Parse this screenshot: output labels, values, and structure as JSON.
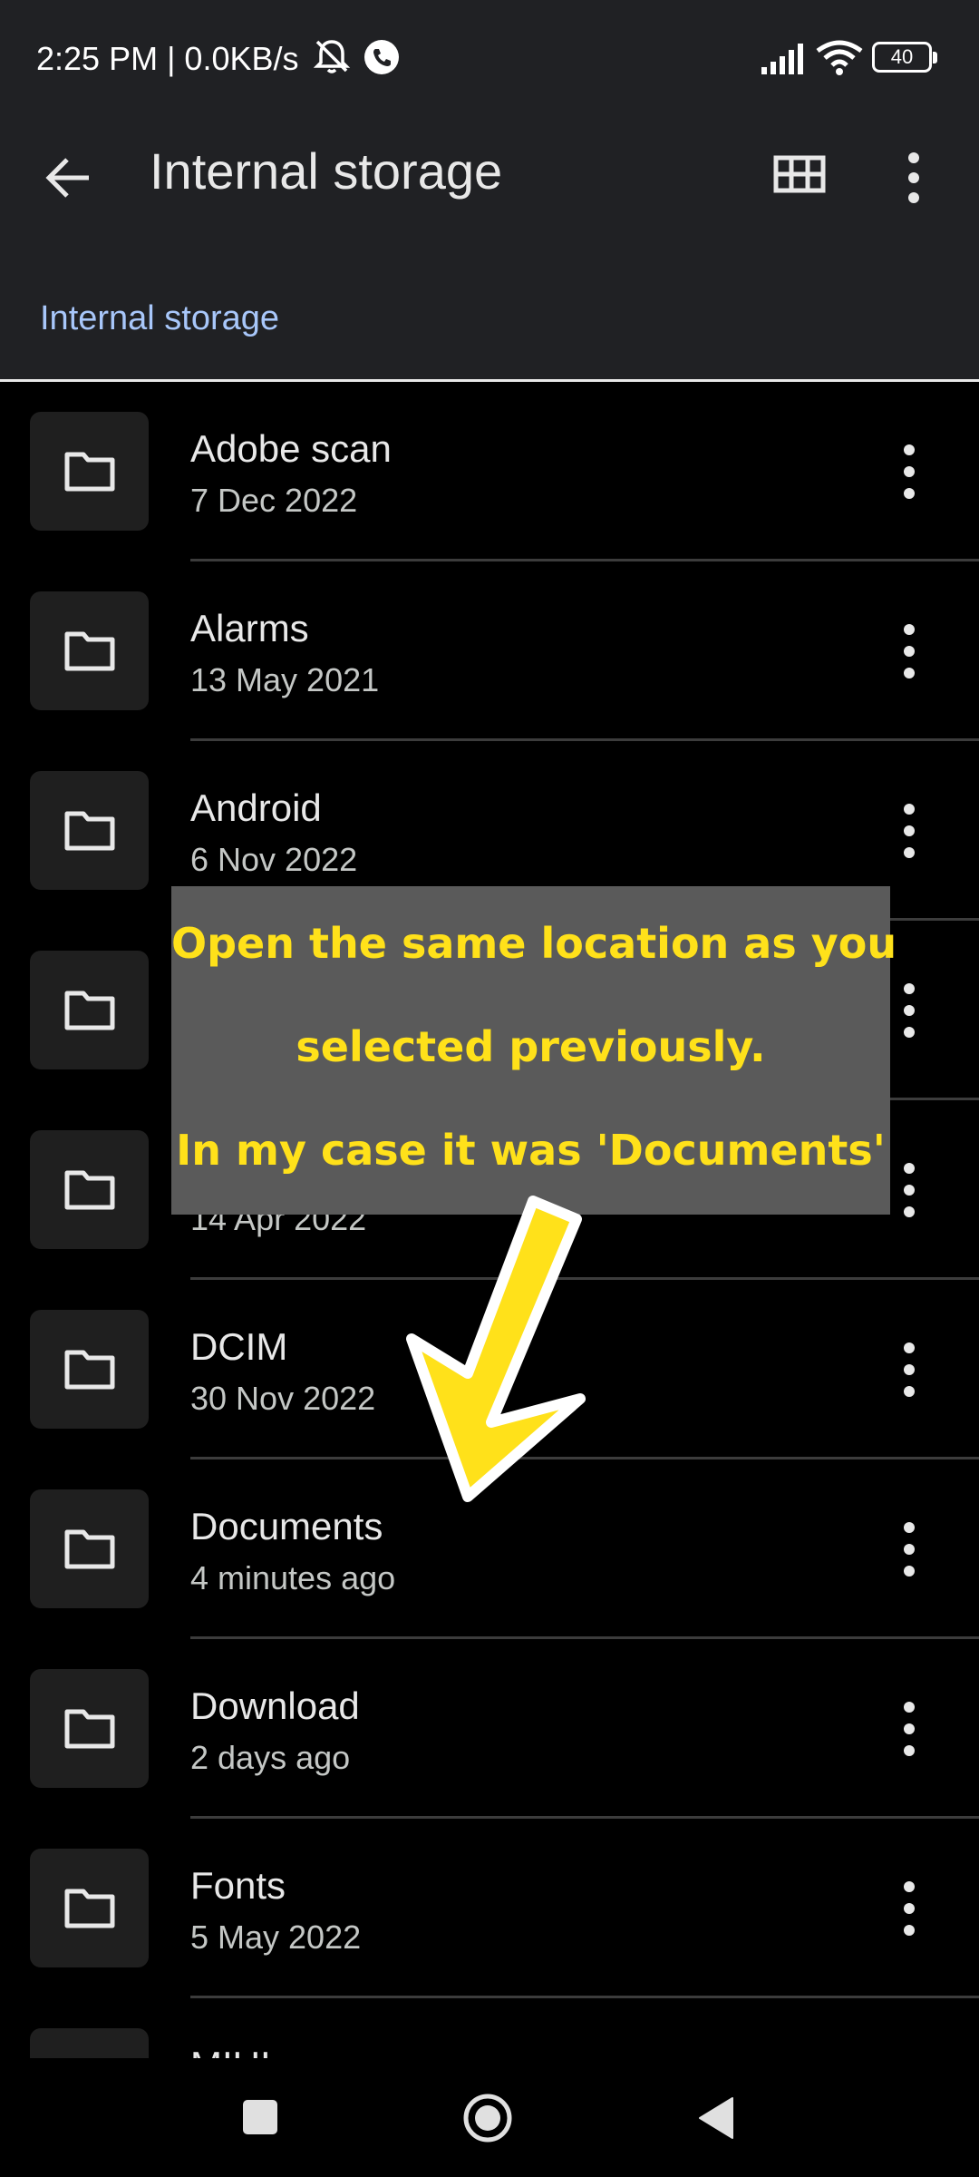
{
  "status_bar": {
    "time": "2:25 PM | 0.0KB/s",
    "battery": "40",
    "icons": [
      "mute-icon",
      "call-icon",
      "signal-icon",
      "wifi-icon",
      "battery-icon"
    ]
  },
  "app_bar": {
    "title": "Internal storage",
    "icons": [
      "back-arrow-icon",
      "grid-view-icon",
      "more-vert-icon"
    ]
  },
  "breadcrumb": "Internal storage",
  "files": [
    {
      "name": "Adobe scan",
      "date": "7 Dec 2022"
    },
    {
      "name": "Alarms",
      "date": "13 May 2021"
    },
    {
      "name": "Android",
      "date": "6 Nov 2022"
    },
    {
      "name": "",
      "date": ""
    },
    {
      "name": "",
      "date": "14 Apr 2022"
    },
    {
      "name": "DCIM",
      "date": "30 Nov 2022"
    },
    {
      "name": "Documents",
      "date": "4 minutes ago"
    },
    {
      "name": "Download",
      "date": "2 days ago"
    },
    {
      "name": "Fonts",
      "date": "5 May 2022"
    },
    {
      "name": "MIUI",
      "date": ""
    }
  ],
  "annotation": {
    "lines": [
      "Open the same location as you",
      "selected previously.",
      "In my case it was 'Documents'"
    ],
    "color": "#ffe11a",
    "box_color": "#5a5a5a"
  },
  "nav_bar": {
    "icons": [
      "recents-square-icon",
      "home-circle-icon",
      "back-triangle-icon"
    ]
  },
  "colors": {
    "surface": "#202124",
    "background": "#000000",
    "accent": "#a8c7fa",
    "folder_tile": "#1f1f1f"
  }
}
